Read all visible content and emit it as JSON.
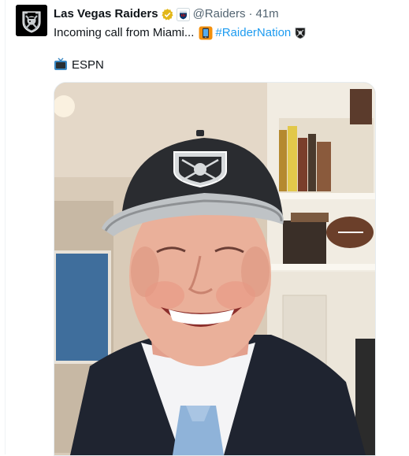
{
  "account": {
    "display_name": "Las Vegas Raiders",
    "handle": "@Raiders",
    "separator": "·",
    "time": "41m"
  },
  "tweet": {
    "text": "Incoming call from Miami...",
    "hashtag": "#RaiderNation",
    "source": "ESPN"
  },
  "icons": {
    "avatar": "raiders-shield-logo",
    "verified": "gold-verified-badge-icon",
    "affiliation": "nfl-shield-icon",
    "phone": "mobile-phone-emoji",
    "raiders_emoji": "raiders-shield-emoji",
    "source": "television-emoji"
  },
  "colors": {
    "link": "#1d9bf0",
    "secondary_text": "#536471",
    "verified_gold": "#e2b719"
  },
  "media": {
    "type": "video-still",
    "alt": ""
  }
}
